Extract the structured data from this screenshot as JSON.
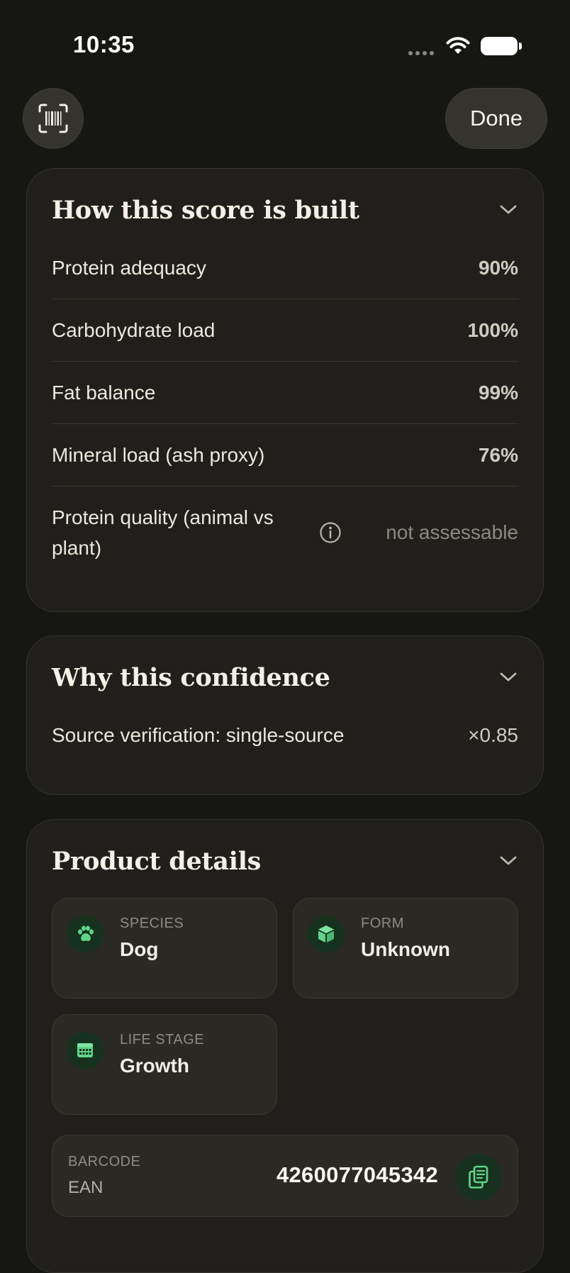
{
  "status_bar": {
    "time": "10:35"
  },
  "header": {
    "done_label": "Done"
  },
  "score_card": {
    "title": "How this score is built",
    "rows": [
      {
        "label": "Protein adequacy",
        "value": "90%"
      },
      {
        "label": "Carbohydrate load",
        "value": "100%"
      },
      {
        "label": "Fat balance",
        "value": "99%"
      },
      {
        "label": "Mineral load (ash proxy)",
        "value": "76%"
      },
      {
        "label": "Protein quality (animal vs plant)",
        "value": "not assessable"
      }
    ]
  },
  "confidence_card": {
    "title": "Why this confidence",
    "rows": [
      {
        "label": "Source verification: single-source",
        "value": "×0.85"
      }
    ]
  },
  "details_card": {
    "title": "Product details",
    "tiles": [
      {
        "caption": "SPECIES",
        "value": "Dog",
        "icon": "paw-icon"
      },
      {
        "caption": "FORM",
        "value": "Unknown",
        "icon": "box-icon"
      },
      {
        "caption": "LIFE STAGE",
        "value": "Growth",
        "icon": "calendar-icon"
      }
    ],
    "barcode": {
      "caption": "BARCODE",
      "type": "EAN",
      "number": "4260077045342"
    }
  },
  "colors": {
    "background": "#161612",
    "card": "#201f1b",
    "accent_green": "#5fd487"
  }
}
